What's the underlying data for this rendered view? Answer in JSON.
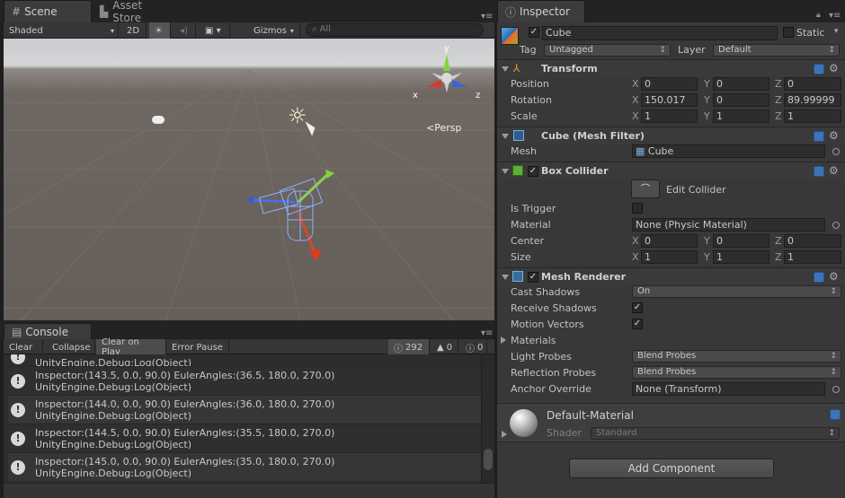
{
  "scene": {
    "tab_scene": "Scene",
    "tab_asset_store": "Asset Store",
    "shading": "Shaded",
    "btn_2d": "2D",
    "gizmos": "Gizmos",
    "search_placeholder": "All",
    "persp": "Persp",
    "axis_x": "x",
    "axis_y": "y",
    "axis_z": "z"
  },
  "console": {
    "tab": "Console",
    "clear": "Clear",
    "collapse": "Collapse",
    "clear_on_play": "Clear on Play",
    "error_pause": "Error Pause",
    "log_count": "292",
    "warn_count": "0",
    "error_count": "0",
    "partial_line": "UnityEngine.Debug:Log(Object)",
    "entries": [
      {
        "line1": "Inspector:(143.5, 0.0, 90.0) EulerAngles:(36.5, 180.0, 270.0)",
        "line2": "UnityEngine.Debug:Log(Object)"
      },
      {
        "line1": "Inspector:(144.0, 0.0, 90.0) EulerAngles:(36.0, 180.0, 270.0)",
        "line2": "UnityEngine.Debug:Log(Object)"
      },
      {
        "line1": "Inspector:(144.5, 0.0, 90.0) EulerAngles:(35.5, 180.0, 270.0)",
        "line2": "UnityEngine.Debug:Log(Object)"
      },
      {
        "line1": "Inspector:(145.0, 0.0, 90.0) EulerAngles:(35.0, 180.0, 270.0)",
        "line2": "UnityEngine.Debug:Log(Object)"
      }
    ]
  },
  "inspector": {
    "tab": "Inspector",
    "object_name": "Cube",
    "static": "Static",
    "tag_label": "Tag",
    "tag_value": "Untagged",
    "layer_label": "Layer",
    "layer_value": "Default",
    "transform": {
      "title": "Transform",
      "position": "Position",
      "rotation": "Rotation",
      "scale": "Scale",
      "pos": [
        "0",
        "0",
        "0"
      ],
      "rot": [
        "150.017",
        "0",
        "89.99999"
      ],
      "scl": [
        "1",
        "1",
        "1"
      ]
    },
    "mesh_filter": {
      "title": "Cube (Mesh Filter)",
      "mesh_label": "Mesh",
      "mesh_value": "Cube"
    },
    "box_collider": {
      "title": "Box Collider",
      "edit": "Edit Collider",
      "is_trigger": "Is Trigger",
      "material": "Material",
      "material_value": "None (Physic Material)",
      "center": "Center",
      "size": "Size",
      "ctr": [
        "0",
        "0",
        "0"
      ],
      "sz": [
        "1",
        "1",
        "1"
      ]
    },
    "mesh_renderer": {
      "title": "Mesh Renderer",
      "cast_shadows": "Cast Shadows",
      "cast_value": "On",
      "receive_shadows": "Receive Shadows",
      "motion_vectors": "Motion Vectors",
      "materials": "Materials",
      "light_probes": "Light Probes",
      "light_value": "Blend Probes",
      "reflection_probes": "Reflection Probes",
      "reflection_value": "Blend Probes",
      "anchor_override": "Anchor Override",
      "anchor_value": "None (Transform)"
    },
    "material": {
      "name": "Default-Material",
      "shader_label": "Shader",
      "shader_value": "Standard"
    },
    "add_component": "Add Component",
    "x": "X",
    "y": "Y",
    "z": "Z"
  }
}
